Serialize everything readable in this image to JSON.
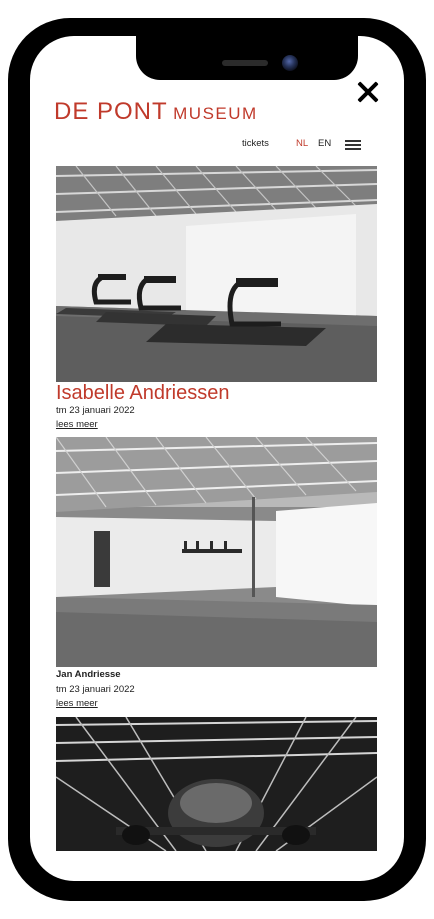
{
  "header": {
    "logo_main": "DE PONT",
    "logo_sub": "MUSEUM"
  },
  "nav": {
    "tickets": "tickets",
    "lang_nl": "NL",
    "lang_en": "EN"
  },
  "exhibitions": [
    {
      "title": "Isabelle Andriessen",
      "date": "tm 23 januari 2022",
      "link": "lees meer"
    },
    {
      "title": "Jan Andriesse",
      "date": "tm 23 januari 2022",
      "link": "lees meer"
    }
  ],
  "colors": {
    "brand": "#c03a2b",
    "phone_frame": "#000000"
  },
  "icons": {
    "close": "close-icon",
    "menu": "hamburger-menu-icon",
    "camera": "front-camera"
  }
}
